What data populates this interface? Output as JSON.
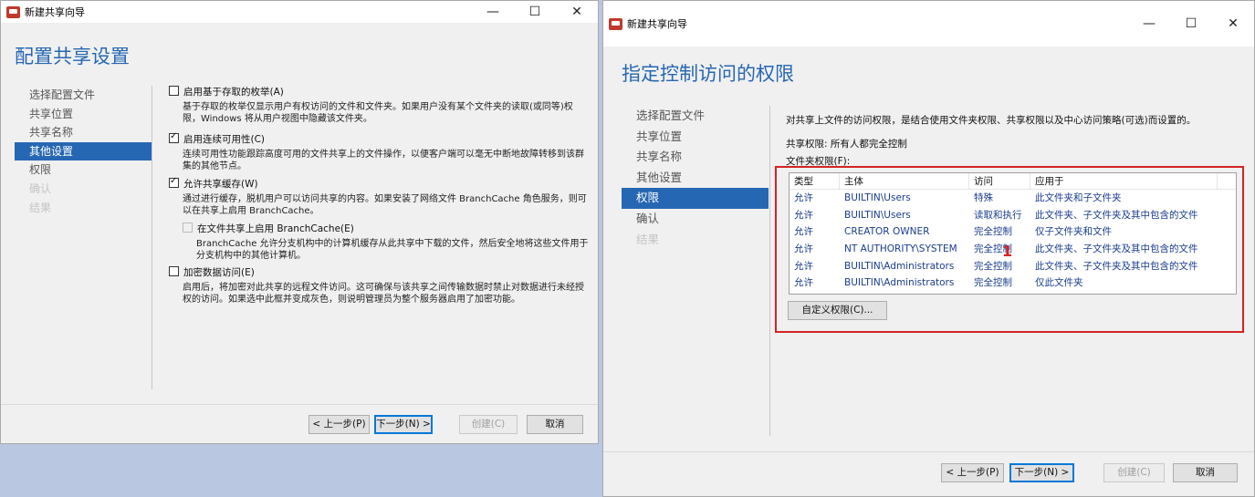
{
  "left_window": {
    "title": "新建共享向导",
    "heading": "配置共享设置",
    "nav": [
      "选择配置文件",
      "共享位置",
      "共享名称",
      "其他设置",
      "权限",
      "确认",
      "结果"
    ],
    "options": [
      {
        "label": "启用基于存取的枚举(A)",
        "checked": false,
        "desc": "基于存取的枚举仅显示用户有权访问的文件和文件夹。如果用户没有某个文件夹的读取(或同等)权限，Windows 将从用户视图中隐藏该文件夹。"
      },
      {
        "label": "启用连续可用性(C)",
        "checked": true,
        "desc": "连续可用性功能跟踪高度可用的文件共享上的文件操作，以便客户端可以毫无中断地故障转移到该群集的其他节点。"
      },
      {
        "label": "允许共享缓存(W)",
        "checked": true,
        "desc": "通过进行缓存，脱机用户可以访问共享的内容。如果安装了网络文件 BranchCache 角色服务，则可以在共享上启用 BranchCache。"
      },
      {
        "label": "在文件共享上启用 BranchCache(E)",
        "checked": false,
        "disabled": true,
        "desc": "BranchCache 允许分支机构中的计算机缓存从此共享中下载的文件，然后安全地将这些文件用于分支机构中的其他计算机。"
      },
      {
        "label": "加密数据访问(E)",
        "checked": false,
        "desc": "启用后，将加密对此共享的远程文件访问。这可确保与该共享之间传输数据时禁止对数据进行未经授权的访问。如果选中此框并变成灰色，则说明管理员为整个服务器启用了加密功能。"
      }
    ],
    "buttons": {
      "prev": "< 上一步(P)",
      "next": "下一步(N) >",
      "create": "创建(C)",
      "cancel": "取消"
    }
  },
  "right_window": {
    "title": "新建共享向导",
    "heading": "指定控制访问的权限",
    "nav": [
      "选择配置文件",
      "共享位置",
      "共享名称",
      "其他设置",
      "权限",
      "确认",
      "结果"
    ],
    "intro": "对共享上文件的访问权限，是结合使用文件夹权限、共享权限以及中心访问策略(可选)而设置的。",
    "share_permission": "共享权限: 所有人都完全控制",
    "folder_permission_label": "文件夹权限(F):",
    "table": {
      "headers": [
        "类型",
        "主体",
        "访问",
        "应用于"
      ],
      "rows": [
        [
          "允许",
          "BUILTIN\\Users",
          "特殊",
          "此文件夹和子文件夹"
        ],
        [
          "允许",
          "BUILTIN\\Users",
          "读取和执行",
          "此文件夹、子文件夹及其中包含的文件"
        ],
        [
          "允许",
          "CREATOR OWNER",
          "完全控制",
          "仅子文件夹和文件"
        ],
        [
          "允许",
          "NT AUTHORITY\\SYSTEM",
          "完全控制",
          "此文件夹、子文件夹及其中包含的文件"
        ],
        [
          "允许",
          "BUILTIN\\Administrators",
          "完全控制",
          "此文件夹、子文件夹及其中包含的文件"
        ],
        [
          "允许",
          "BUILTIN\\Administrators",
          "完全控制",
          "仅此文件夹"
        ]
      ]
    },
    "custom_button": "自定义权限(C)...",
    "marker": "1",
    "buttons": {
      "prev": "< 上一步(P)",
      "next": "下一步(N) >",
      "create": "创建(C)",
      "cancel": "取消"
    }
  },
  "window_controls": {
    "minimize": "—",
    "maximize": "☐",
    "close": "✕"
  },
  "colors": {
    "accent": "#2667b3",
    "highlight_box": "#d32424"
  }
}
